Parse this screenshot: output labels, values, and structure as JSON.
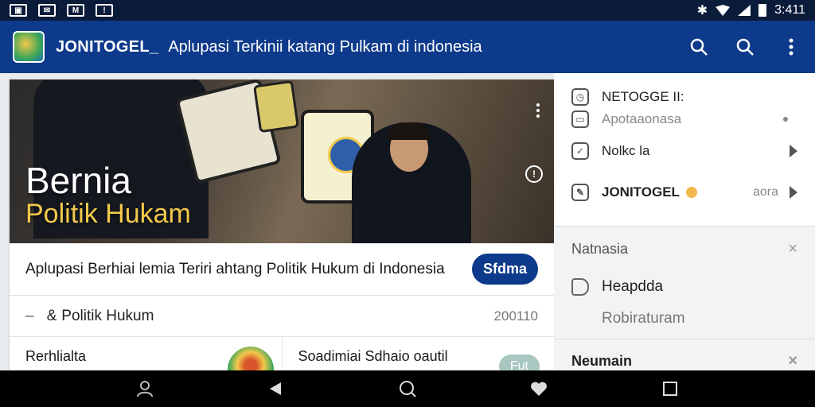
{
  "status": {
    "left_icons": [
      "image-icon",
      "mail-icon",
      "m-icon",
      "notification-icon"
    ],
    "time": "3:411"
  },
  "appbar": {
    "brand": "JONITOGEL_",
    "subtitle": "Aplupasi Terkinii katang Pulkam di indonesia"
  },
  "hero": {
    "title": "Bernia",
    "subtitle": "Politik Hukam"
  },
  "headline": {
    "text": "Aplupasi Berhiai lemia  Teriri ahtang Politik Hukum di Indonesia",
    "button": "Sfdma"
  },
  "category": {
    "dash": "–",
    "amp": "&",
    "label": "Politik Hukum",
    "count": "200110"
  },
  "cards": [
    {
      "label": "Rerhlialta"
    },
    {
      "label": "Soadimiai Sdhaio oautil",
      "pill": "Fut"
    }
  ],
  "side": {
    "item1": "NETOGGE II:",
    "item2": "Apotaaonasa",
    "item3": "Nolkc la",
    "item4": "JONITOGEL",
    "item4_meta": "aora",
    "section1": {
      "title": "Natnasia",
      "close": "×",
      "item_a": "Heapdda",
      "item_b": "Robiraturam"
    },
    "section2": {
      "title": "Neumain",
      "close": "×"
    }
  },
  "colors": {
    "appbar": "#0d3a8a",
    "accent": "#f2c94c",
    "pill": "#0d3a8a"
  }
}
